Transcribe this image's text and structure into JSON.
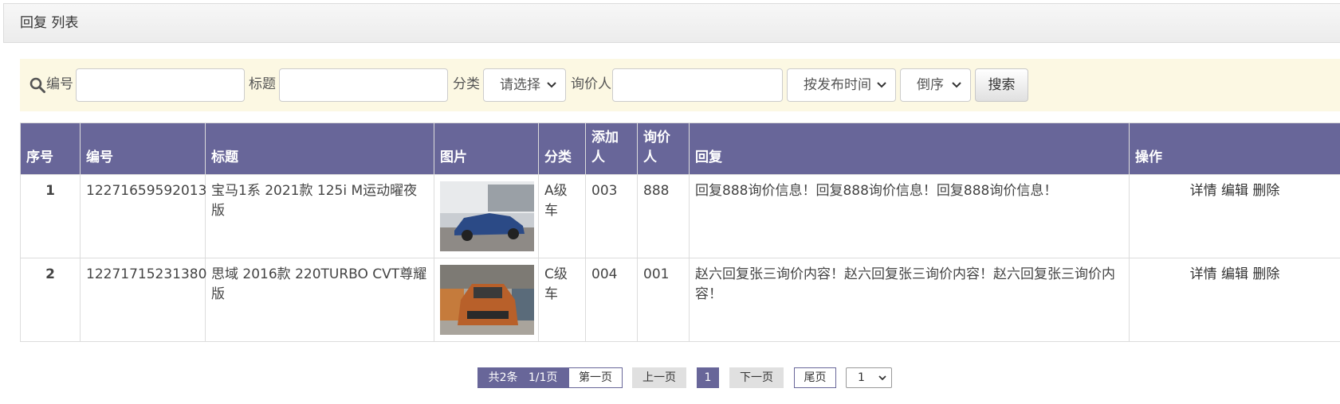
{
  "header": {
    "title": "回复 列表"
  },
  "search": {
    "labels": {
      "id": "编号",
      "title": "标题",
      "category": "分类",
      "inquirer": "询价人"
    },
    "inputs": {
      "id": "",
      "title": "",
      "inquirer": ""
    },
    "category_select": "请选择",
    "sort_field_select": "按发布时间",
    "sort_order_select": "倒序",
    "search_button": "搜索"
  },
  "table": {
    "headers": [
      "序号",
      "编号",
      "标题",
      "图片",
      "分类",
      "添加人",
      "询价人",
      "回复",
      "操作"
    ],
    "rows": [
      {
        "seq": "1",
        "id": "12271659592013",
        "title": "宝马1系 2021款 125i M运动曜夜版",
        "category": "A级车",
        "adder": "003",
        "inquirer": "888",
        "reply": "回复888询价信息！回复888询价信息！回复888询价信息！",
        "car_color": "#2b4a86"
      },
      {
        "seq": "2",
        "id": "12271715231380",
        "title": "思域 2016款 220TURBO CVT尊耀版",
        "category": "C级车",
        "adder": "004",
        "inquirer": "001",
        "reply": "赵六回复张三询价内容！赵六回复张三询价内容！赵六回复张三询价内容！",
        "car_color": "#b8602a"
      }
    ],
    "actions": {
      "detail": "详情",
      "edit": "编辑",
      "delete": "删除"
    }
  },
  "pagination": {
    "total": "共2条",
    "pages": "1/1页",
    "first": "第一页",
    "prev": "上一页",
    "current": "1",
    "next": "下一页",
    "last": "尾页",
    "page_select": "1"
  },
  "colors": {
    "accent": "#686699",
    "search_bg": "#fcf8e3"
  }
}
